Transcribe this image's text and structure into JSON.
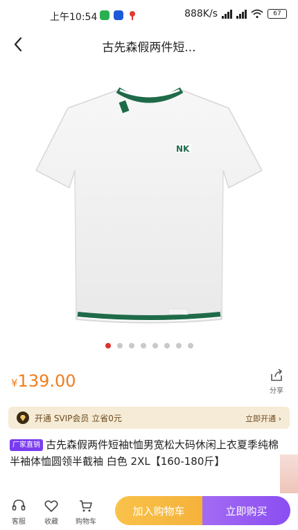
{
  "status_bar": {
    "time": "上午10:54",
    "network_speed": "888K/s",
    "battery": "67",
    "app_icons": [
      "wechat-icon",
      "app-icon",
      "location-icon"
    ],
    "colors": {
      "wechat": "#2ab050",
      "app": "#1e5ad8",
      "location": "#e23a2f"
    }
  },
  "nav": {
    "title": "古先森假两件短..."
  },
  "product": {
    "image_icon": "white-tshirt-image",
    "logo_text": "NK",
    "carousel": {
      "total": 8,
      "active_index": 0
    }
  },
  "price": {
    "currency": "¥",
    "value": "139.00",
    "color": "#f07d1c"
  },
  "share": {
    "label": "分享"
  },
  "svip": {
    "text": "开通 SVIP会员 立省0元",
    "action": "立即开通 ›"
  },
  "description": {
    "badge": "厂家直销",
    "text": "古先森假两件短袖t恤男宽松大码休闲上衣夏季纯棉半袖体恤圆领半截袖 白色 2XL【160-180斤】"
  },
  "bottom_bar": {
    "service": "客服",
    "favorite": "收藏",
    "cart": "购物车",
    "add_to_cart": "加入购物车",
    "buy_now": "立即购买"
  }
}
